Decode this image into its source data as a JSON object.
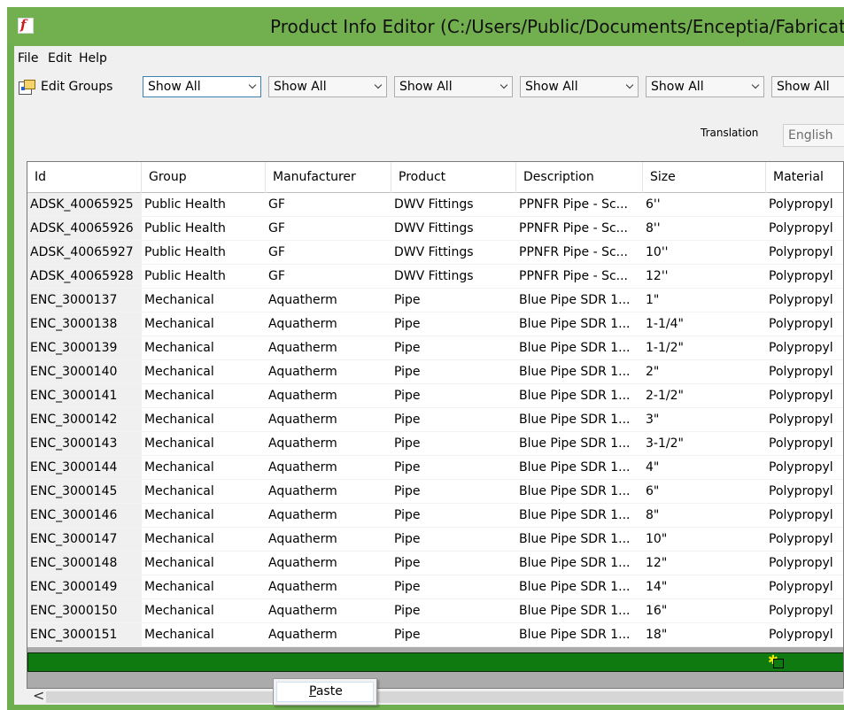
{
  "window": {
    "title": "Product Info Editor (C:/Users/Public/Documents/Enceptia/Fabrication",
    "app_icon_glyph": "f"
  },
  "menu": [
    "File",
    "Edit",
    "Help"
  ],
  "toolbar": {
    "edit_groups_label": "Edit Groups",
    "filters": [
      "Show All",
      "Show All",
      "Show All",
      "Show All",
      "Show All",
      "Show All"
    ]
  },
  "translation": {
    "label": "Translation",
    "value": "English"
  },
  "grid": {
    "columns": [
      "Id",
      "Group",
      "Manufacturer",
      "Product",
      "Description",
      "Size",
      "Material"
    ],
    "rows": [
      [
        "ADSK_40065925",
        "Public Health",
        "GF",
        "DWV Fittings",
        "PPNFR Pipe - Sc...",
        "6''",
        "Polypropyl"
      ],
      [
        "ADSK_40065926",
        "Public Health",
        "GF",
        "DWV Fittings",
        "PPNFR Pipe - Sc...",
        "8''",
        "Polypropyl"
      ],
      [
        "ADSK_40065927",
        "Public Health",
        "GF",
        "DWV Fittings",
        "PPNFR Pipe - Sc...",
        "10''",
        "Polypropyl"
      ],
      [
        "ADSK_40065928",
        "Public Health",
        "GF",
        "DWV Fittings",
        "PPNFR Pipe - Sc...",
        "12''",
        "Polypropyl"
      ],
      [
        "ENC_3000137",
        "Mechanical",
        "Aquatherm",
        "Pipe",
        "Blue Pipe SDR 1...",
        "1\"",
        "Polypropyl"
      ],
      [
        "ENC_3000138",
        "Mechanical",
        "Aquatherm",
        "Pipe",
        "Blue Pipe SDR 1...",
        "1-1/4\"",
        "Polypropyl"
      ],
      [
        "ENC_3000139",
        "Mechanical",
        "Aquatherm",
        "Pipe",
        "Blue Pipe SDR 1...",
        "1-1/2\"",
        "Polypropyl"
      ],
      [
        "ENC_3000140",
        "Mechanical",
        "Aquatherm",
        "Pipe",
        "Blue Pipe SDR 1...",
        "2\"",
        "Polypropyl"
      ],
      [
        "ENC_3000141",
        "Mechanical",
        "Aquatherm",
        "Pipe",
        "Blue Pipe SDR 1...",
        "2-1/2\"",
        "Polypropyl"
      ],
      [
        "ENC_3000142",
        "Mechanical",
        "Aquatherm",
        "Pipe",
        "Blue Pipe SDR 1...",
        "3\"",
        "Polypropyl"
      ],
      [
        "ENC_3000143",
        "Mechanical",
        "Aquatherm",
        "Pipe",
        "Blue Pipe SDR 1...",
        "3-1/2\"",
        "Polypropyl"
      ],
      [
        "ENC_3000144",
        "Mechanical",
        "Aquatherm",
        "Pipe",
        "Blue Pipe SDR 1...",
        "4\"",
        "Polypropyl"
      ],
      [
        "ENC_3000145",
        "Mechanical",
        "Aquatherm",
        "Pipe",
        "Blue Pipe SDR 1...",
        "6\"",
        "Polypropyl"
      ],
      [
        "ENC_3000146",
        "Mechanical",
        "Aquatherm",
        "Pipe",
        "Blue Pipe SDR 1...",
        "8\"",
        "Polypropyl"
      ],
      [
        "ENC_3000147",
        "Mechanical",
        "Aquatherm",
        "Pipe",
        "Blue Pipe SDR 1...",
        "10\"",
        "Polypropyl"
      ],
      [
        "ENC_3000148",
        "Mechanical",
        "Aquatherm",
        "Pipe",
        "Blue Pipe SDR 1...",
        "12\"",
        "Polypropyl"
      ],
      [
        "ENC_3000149",
        "Mechanical",
        "Aquatherm",
        "Pipe",
        "Blue Pipe SDR 1...",
        "14\"",
        "Polypropyl"
      ],
      [
        "ENC_3000150",
        "Mechanical",
        "Aquatherm",
        "Pipe",
        "Blue Pipe SDR 1...",
        "16\"",
        "Polypropyl"
      ],
      [
        "ENC_3000151",
        "Mechanical",
        "Aquatherm",
        "Pipe",
        "Blue Pipe SDR 1...",
        "18\"",
        "Polypropyl"
      ]
    ]
  },
  "scrollbar": {
    "left_arrow_glyph": "<"
  },
  "context_menu": {
    "items": [
      "Paste"
    ]
  },
  "colors": {
    "title_bar": "#72b04f",
    "new_row": "#0f7a0f",
    "app_icon": "#cc1b1b"
  }
}
